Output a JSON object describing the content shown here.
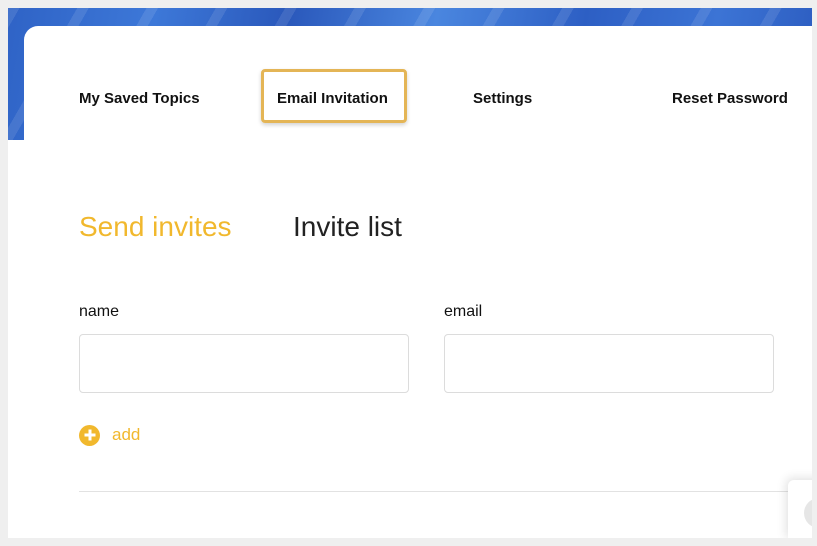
{
  "nav": {
    "tabs": [
      {
        "label": "My Saved Topics"
      },
      {
        "label": "Email Invitation",
        "highlighted": true
      },
      {
        "label": "Settings"
      },
      {
        "label": "Reset Password"
      }
    ]
  },
  "subtabs": {
    "active": {
      "label": "Send invites"
    },
    "inactive": {
      "label": "Invite list"
    }
  },
  "form": {
    "name_label": "name",
    "name_value": "",
    "email_label": "email",
    "email_value": "",
    "add_label": "add"
  },
  "colors": {
    "accent": "#f1b82d",
    "highlight_border": "#e4b556",
    "banner": "#2f63c6"
  }
}
